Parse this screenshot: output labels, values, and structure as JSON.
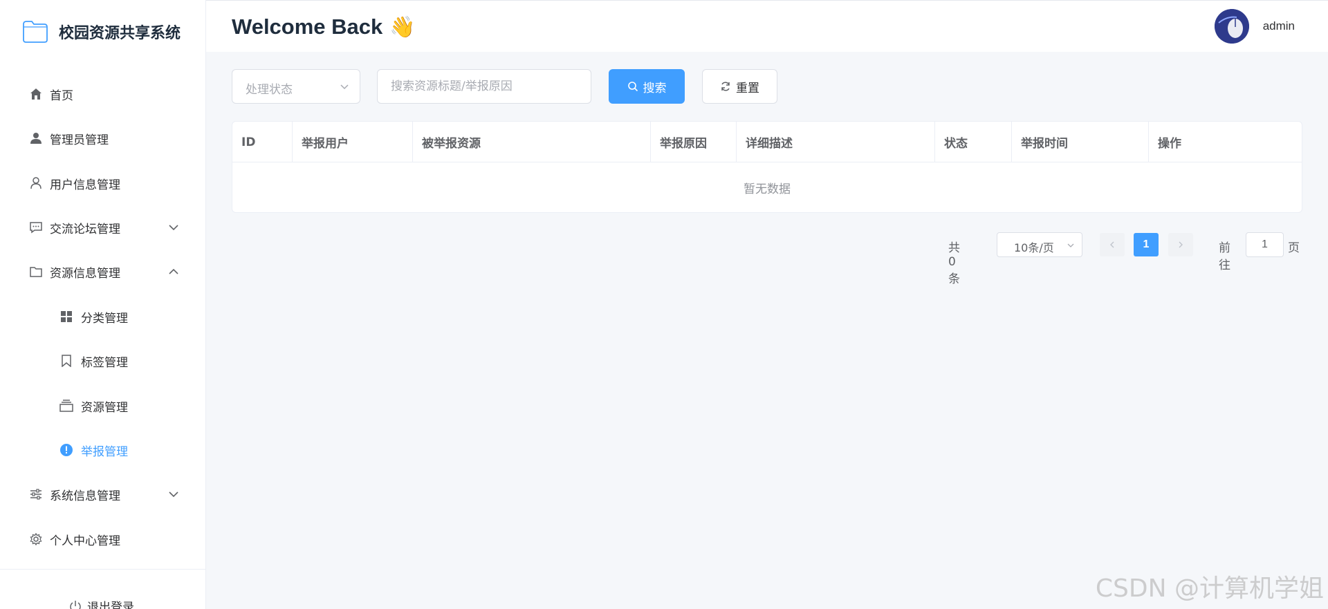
{
  "brand": {
    "title": "校园资源共享系统",
    "accent": "#409eff"
  },
  "sidebar": {
    "items": [
      {
        "label": "首页",
        "icon": "home-icon"
      },
      {
        "label": "管理员管理",
        "icon": "user-filled-icon"
      },
      {
        "label": "用户信息管理",
        "icon": "user-icon"
      },
      {
        "label": "交流论坛管理",
        "icon": "chat-icon",
        "expandable": true,
        "expanded": false
      },
      {
        "label": "资源信息管理",
        "icon": "folder-icon",
        "expandable": true,
        "expanded": true
      },
      {
        "label": "分类管理",
        "icon": "grid-icon",
        "sub": true
      },
      {
        "label": "标签管理",
        "icon": "bookmark-icon",
        "sub": true
      },
      {
        "label": "资源管理",
        "icon": "box-icon",
        "sub": true
      },
      {
        "label": "举报管理",
        "icon": "warning-icon",
        "sub": true,
        "active": true
      },
      {
        "label": "系统信息管理",
        "icon": "sliders-icon",
        "expandable": true,
        "expanded": false
      },
      {
        "label": "个人中心管理",
        "icon": "gear-icon"
      }
    ],
    "logout_label": "退出登录"
  },
  "header": {
    "welcome": "Welcome Back",
    "wave": "👋",
    "username": "admin"
  },
  "filters": {
    "status_placeholder": "处理状态",
    "search_placeholder": "搜索资源标题/举报原因",
    "search_button": "搜索",
    "reset_button": "重置"
  },
  "table": {
    "columns": [
      "ID",
      "举报用户",
      "被举报资源",
      "举报原因",
      "详细描述",
      "状态",
      "举报时间",
      "操作"
    ],
    "rows": [],
    "empty_text": "暂无数据"
  },
  "pagination": {
    "total_text": "共 0 条",
    "page_size": "10条/页",
    "current_page": "1",
    "goto_label": "前往",
    "goto_value": "1",
    "page_suffix": "页"
  },
  "watermark": "CSDN @计算机学姐"
}
